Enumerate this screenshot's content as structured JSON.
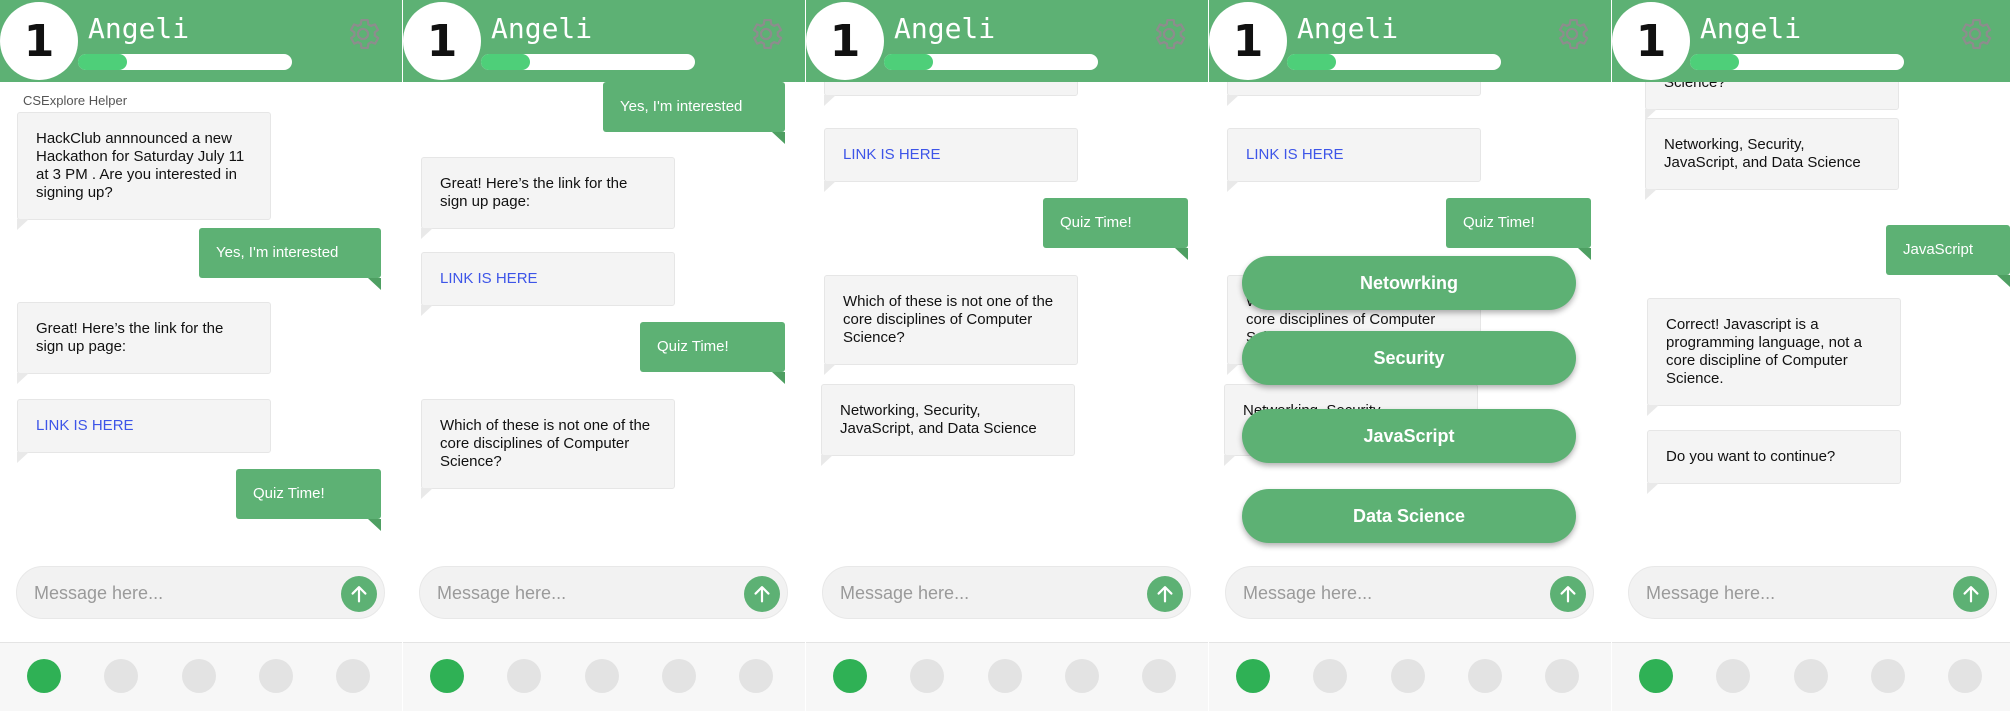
{
  "app": {
    "level": "1",
    "user_name": "Angeli",
    "xp_progress": 0.23,
    "sender_label": "CSExplore Helper",
    "input_placeholder": "Message here...",
    "icons": {
      "settings": "gear-icon",
      "send": "arrow-up-icon"
    },
    "colors": {
      "brand": "#5db174",
      "progress": "#4ecf79",
      "link": "#3d55e8",
      "active_dot": "#2fb155"
    }
  },
  "messages": {
    "announcement": "HackClub annnounced a new Hackathon for Saturday July 11 at 3 PM . Are you interested in signing up?",
    "interested": "Yes, I'm interested",
    "link_intro": "Great! Here’s the link for the sign up page:",
    "link": "LINK IS HERE",
    "quiz_time": "Quiz Time!",
    "question": "Which of these is not one of the core disciplines of Computer Science?",
    "options_text": "Networking, Security, JavaScript, and Data Science",
    "answer": "JavaScript",
    "correct": "Correct! Javascript is a programming language, not a core discipline of Computer Science.",
    "continue": "Do you want to continue?"
  },
  "options": [
    "Netowrking",
    "Security",
    "JavaScript",
    "Data Science"
  ],
  "pagination": {
    "total_steps": 5,
    "current_step": 1
  }
}
